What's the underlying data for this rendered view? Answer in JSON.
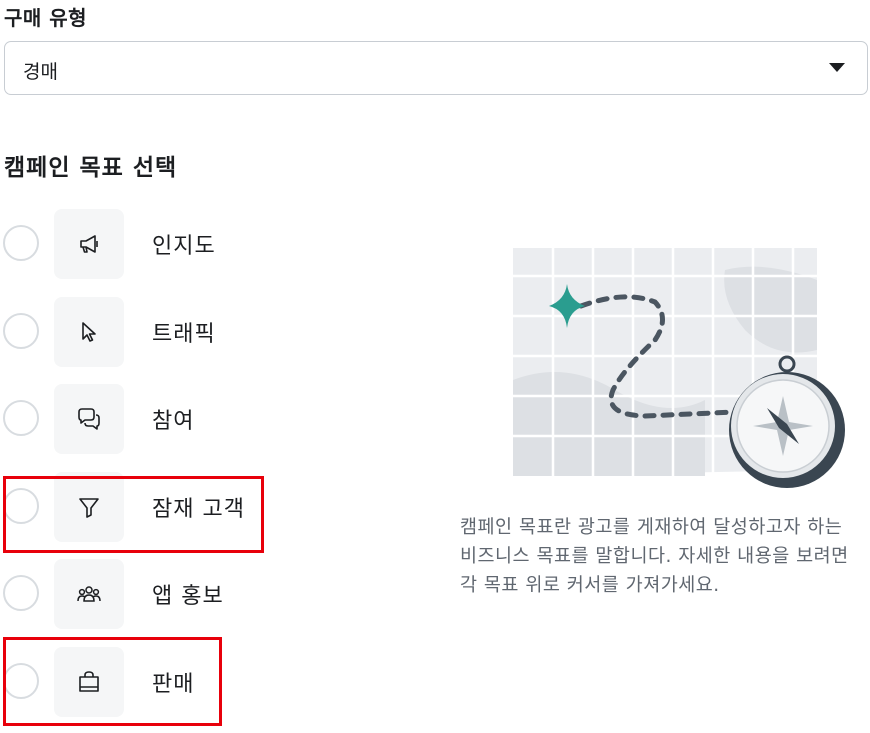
{
  "purchase_type": {
    "label": "구매 유형",
    "selected": "경매"
  },
  "objective": {
    "heading": "캠페인 목표 선택",
    "items": [
      {
        "label": "인지도",
        "icon": "megaphone-icon"
      },
      {
        "label": "트래픽",
        "icon": "cursor-icon"
      },
      {
        "label": "참여",
        "icon": "chat-bubbles-icon"
      },
      {
        "label": "잠재 고객",
        "icon": "funnel-icon"
      },
      {
        "label": "앱 홍보",
        "icon": "people-icon"
      },
      {
        "label": "판매",
        "icon": "shopping-bag-icon"
      }
    ],
    "description": "캠페인 목표란 광고를 게재하여 달성하고자 하는 비즈니스 목표를 말합니다. 자세한 내용을 보려면 각 목표 위로 커서를 가져가세요."
  },
  "colors": {
    "highlight": "#e8000b",
    "map_star": "#2a9d8f",
    "compass": "#3a4651"
  }
}
